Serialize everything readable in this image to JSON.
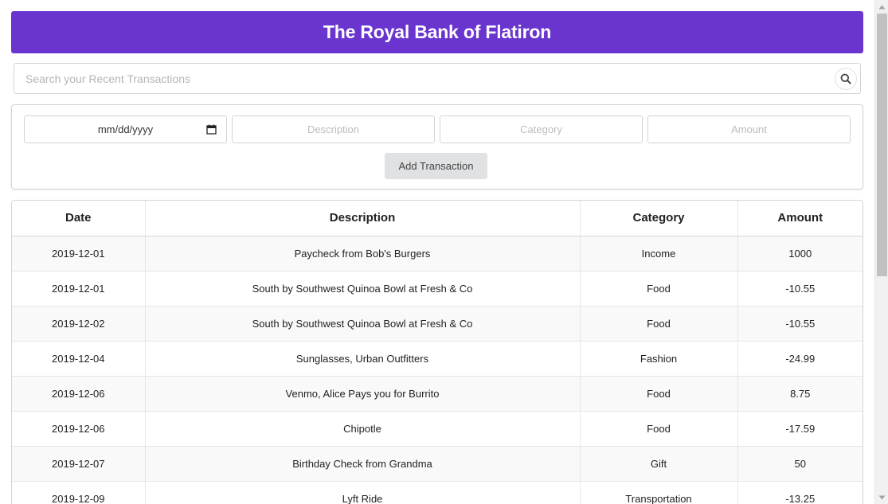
{
  "header": {
    "title": "The Royal Bank of Flatiron"
  },
  "search": {
    "placeholder": "Search your Recent Transactions",
    "icon": "search-icon"
  },
  "form": {
    "date_placeholder": "mm/dd/yyyy",
    "description_placeholder": "Description",
    "category_placeholder": "Category",
    "amount_placeholder": "Amount",
    "submit_label": "Add Transaction"
  },
  "table": {
    "columns": [
      "Date",
      "Description",
      "Category",
      "Amount"
    ],
    "rows": [
      [
        "2019-12-01",
        "Paycheck from Bob's Burgers",
        "Income",
        "1000"
      ],
      [
        "2019-12-01",
        "South by Southwest Quinoa Bowl at Fresh & Co",
        "Food",
        "-10.55"
      ],
      [
        "2019-12-02",
        "South by Southwest Quinoa Bowl at Fresh & Co",
        "Food",
        "-10.55"
      ],
      [
        "2019-12-04",
        "Sunglasses, Urban Outfitters",
        "Fashion",
        "-24.99"
      ],
      [
        "2019-12-06",
        "Venmo, Alice Pays you for Burrito",
        "Food",
        "8.75"
      ],
      [
        "2019-12-06",
        "Chipotle",
        "Food",
        "-17.59"
      ],
      [
        "2019-12-07",
        "Birthday Check from Grandma",
        "Gift",
        "50"
      ],
      [
        "2019-12-09",
        "Lyft Ride",
        "Transportation",
        "-13.25"
      ]
    ]
  },
  "colors": {
    "header_bg": "#6a35cf",
    "header_text": "#ffffff",
    "button_bg": "#e0e1e2"
  }
}
